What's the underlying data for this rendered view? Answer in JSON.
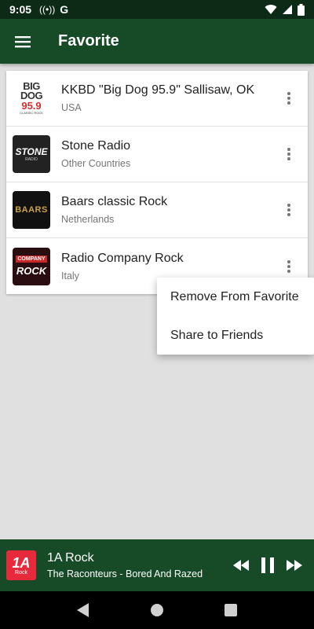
{
  "status_bar": {
    "time": "9:05",
    "carrier_glyph": "G",
    "icons": [
      "radio-signal-icon",
      "wifi-icon",
      "cellular-icon",
      "battery-icon"
    ]
  },
  "app_bar": {
    "title": "Favorite"
  },
  "stations": [
    {
      "name": "KKBD \"Big Dog 95.9\" Sallisaw, OK",
      "country": "USA",
      "logo_lines": [
        "BIG",
        "DOG",
        "95.9",
        "CLASSIC ROCK"
      ]
    },
    {
      "name": "Stone Radio",
      "country": "Other Countries",
      "logo_lines": [
        "STONE",
        "RADIO"
      ]
    },
    {
      "name": "Baars classic Rock",
      "country": "Netherlands",
      "logo_lines": [
        "BAARS"
      ]
    },
    {
      "name": "Radio Company Rock",
      "country": "Italy",
      "logo_lines": [
        "COMPANY",
        "ROCK"
      ]
    }
  ],
  "popup_menu": {
    "items": [
      "Remove From Favorite",
      "Share to Friends"
    ]
  },
  "player": {
    "logo_big": "1A",
    "logo_small": "Rock",
    "title": "1A Rock",
    "subtitle": "The Raconteurs - Bored And Razed"
  },
  "colors": {
    "app_bar": "#174a27",
    "status_bar": "#0d2a17",
    "background": "#e0e0e0",
    "player_logo": "#e62a3b"
  }
}
